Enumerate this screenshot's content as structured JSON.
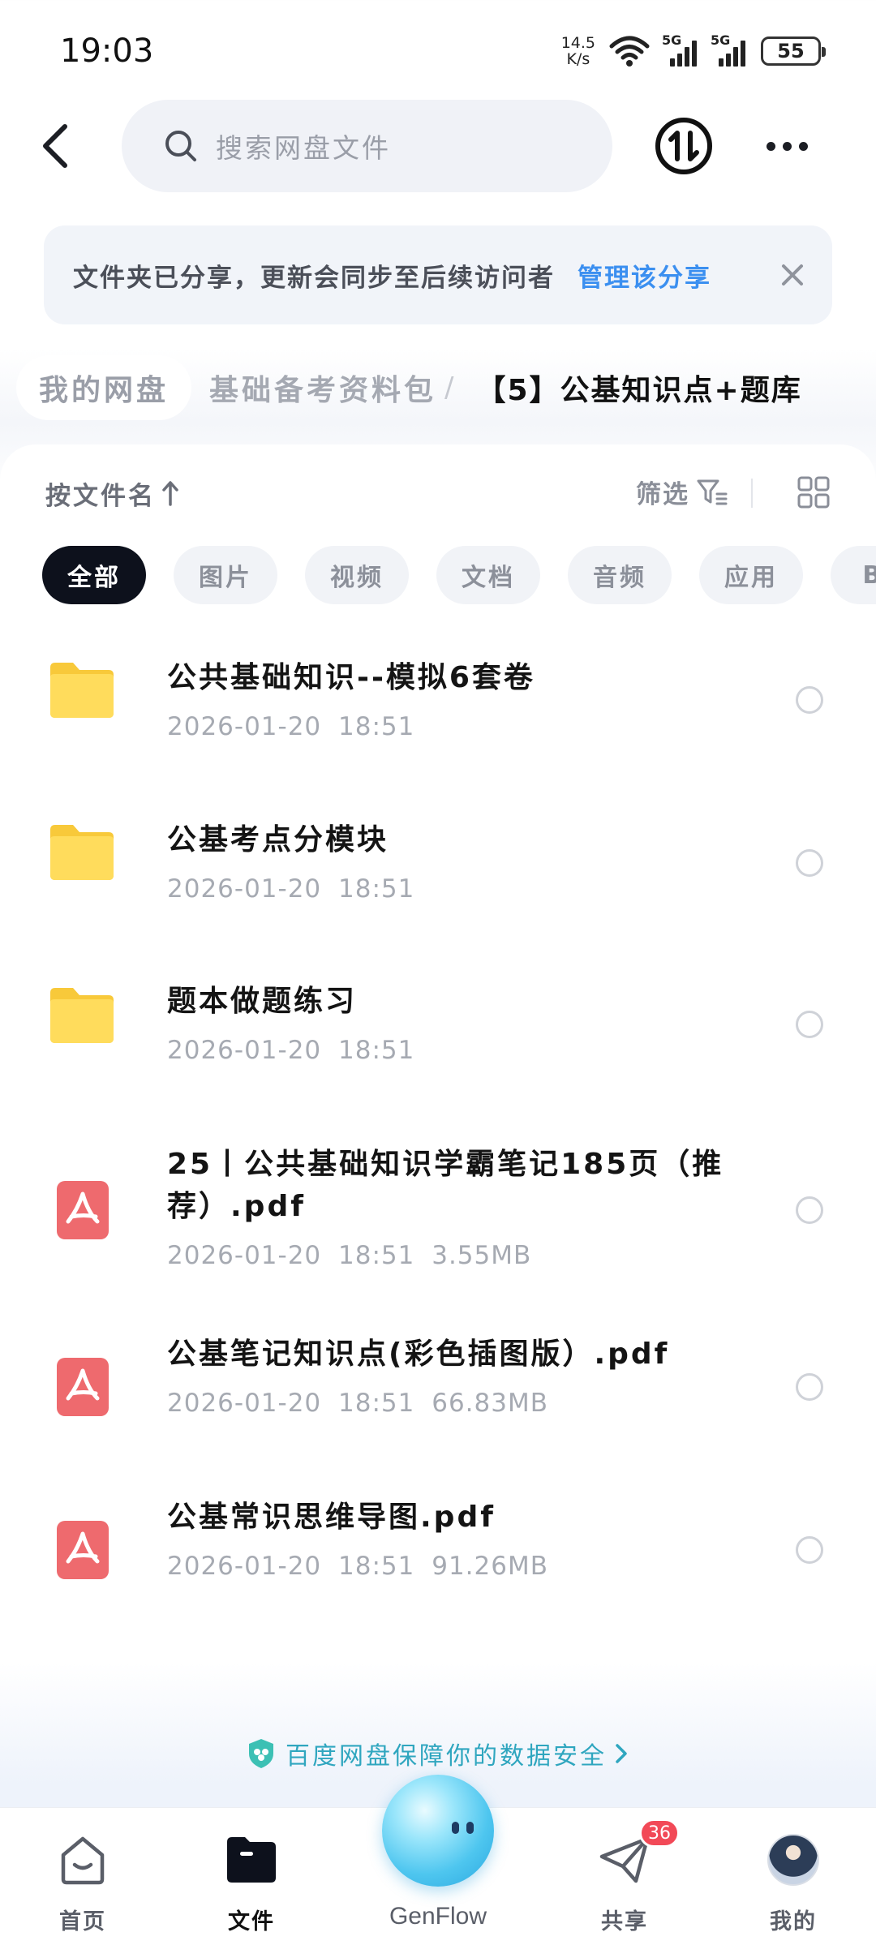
{
  "status_bar": {
    "time": "19:03",
    "net_speed_value": "14.5",
    "net_speed_unit": "K/s",
    "signal1_label": "5G",
    "signal2_label": "5G",
    "battery": "55"
  },
  "top_bar": {
    "search_placeholder": "搜索网盘文件"
  },
  "share_banner": {
    "message": "文件夹已分享，更新会同步至后续访问者",
    "action": "管理该分享"
  },
  "breadcrumb": {
    "root": "我的网盘",
    "parent": "基础备考资料包",
    "separator": "/",
    "current": "【5】公基知识点+题库"
  },
  "toolbar": {
    "sort_label": "按文件名",
    "filter_label": "筛选"
  },
  "chips": [
    {
      "label": "全部",
      "active": true
    },
    {
      "label": "图片",
      "active": false
    },
    {
      "label": "视频",
      "active": false
    },
    {
      "label": "文档",
      "active": false
    },
    {
      "label": "音频",
      "active": false
    },
    {
      "label": "应用",
      "active": false
    },
    {
      "label": "BT",
      "active": false
    }
  ],
  "files": [
    {
      "type": "folder",
      "name": "公共基础知识--模拟6套卷",
      "date": "2026-01-20",
      "time": "18:51",
      "size": ""
    },
    {
      "type": "folder",
      "name": "公基考点分模块",
      "date": "2026-01-20",
      "time": "18:51",
      "size": ""
    },
    {
      "type": "folder",
      "name": "题本做题练习",
      "date": "2026-01-20",
      "time": "18:51",
      "size": ""
    },
    {
      "type": "pdf",
      "name": "25丨公共基础知识学霸笔记185页（推荐）.pdf",
      "date": "2026-01-20",
      "time": "18:51",
      "size": "3.55MB"
    },
    {
      "type": "pdf",
      "name": "公基笔记知识点(彩色插图版）.pdf",
      "date": "2026-01-20",
      "time": "18:51",
      "size": "66.83MB"
    },
    {
      "type": "pdf",
      "name": "公基常识思维导图.pdf",
      "date": "2026-01-20",
      "time": "18:51",
      "size": "91.26MB"
    }
  ],
  "security_notice": "百度网盘保障你的数据安全",
  "bottom_nav": {
    "home": "首页",
    "files": "文件",
    "genflow": "GenFlow",
    "share": "共享",
    "share_badge": "36",
    "mine": "我的"
  },
  "colors": {
    "accent_blue": "#3b8ff0",
    "security_teal": "#2fa6bf",
    "folder_yellow": "#ffd84d",
    "pdf_red": "#ee6a6e",
    "badge_red": "#f24957"
  }
}
